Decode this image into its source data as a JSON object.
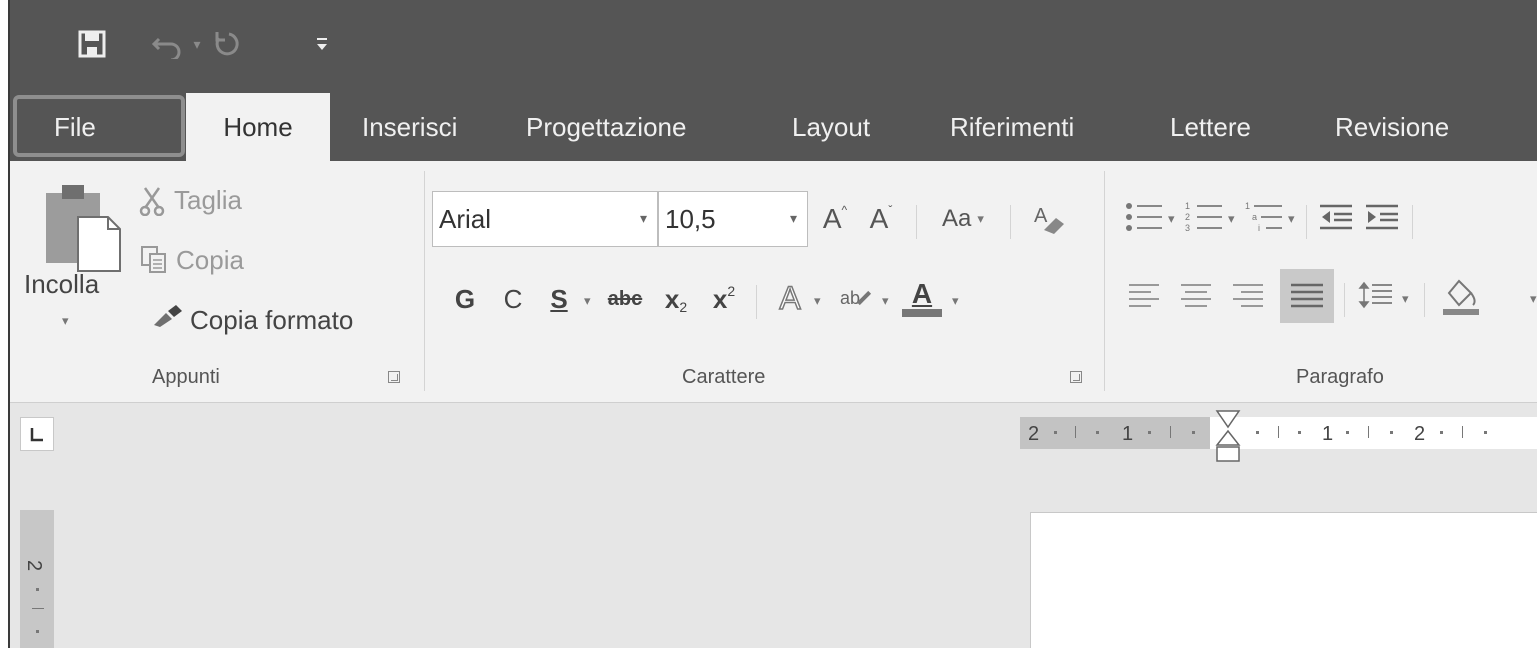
{
  "quick_access": {
    "icons": [
      "save-icon",
      "undo-icon",
      "redo-icon",
      "customize-toolbar-icon"
    ]
  },
  "tabs": [
    {
      "id": "file",
      "label": "File"
    },
    {
      "id": "home",
      "label": "Home"
    },
    {
      "id": "inserisci",
      "label": "Inserisci"
    },
    {
      "id": "progettazione",
      "label": "Progettazione"
    },
    {
      "id": "layout",
      "label": "Layout"
    },
    {
      "id": "riferimenti",
      "label": "Riferimenti"
    },
    {
      "id": "lettere",
      "label": "Lettere"
    },
    {
      "id": "revisione",
      "label": "Revisione"
    }
  ],
  "active_tab": "Home",
  "highlighted_tab": "File",
  "clipboard": {
    "paste_label": "Incolla",
    "cut_label": "Taglia",
    "copy_label": "Copia",
    "format_painter_label": "Copia formato",
    "group_label": "Appunti"
  },
  "font": {
    "font_name": "Arial",
    "font_size": "10,5",
    "change_case_label": "Aa",
    "bold_label": "G",
    "italic_label": "C",
    "underline_label": "S",
    "strike_label": "abc",
    "subscript_label": "x",
    "subscript_index": "2",
    "superscript_label": "x",
    "superscript_index": "2",
    "highlight_label": "ab",
    "font_color_label": "A",
    "text_effects_label": "A",
    "grow_label": "A",
    "shrink_label": "A",
    "group_label": "Carattere"
  },
  "paragraph": {
    "group_label": "Paragrafo",
    "justify_active": true
  },
  "ruler": {
    "labels": [
      "2",
      "1",
      "1",
      "2"
    ]
  },
  "vertical_ruler": {
    "label": "2"
  },
  "colors": {
    "title_bar": "#555555",
    "ribbon": "#f2f2f2",
    "canvas": "#e6e6e6",
    "highlight_box": "#8e8e8e"
  }
}
